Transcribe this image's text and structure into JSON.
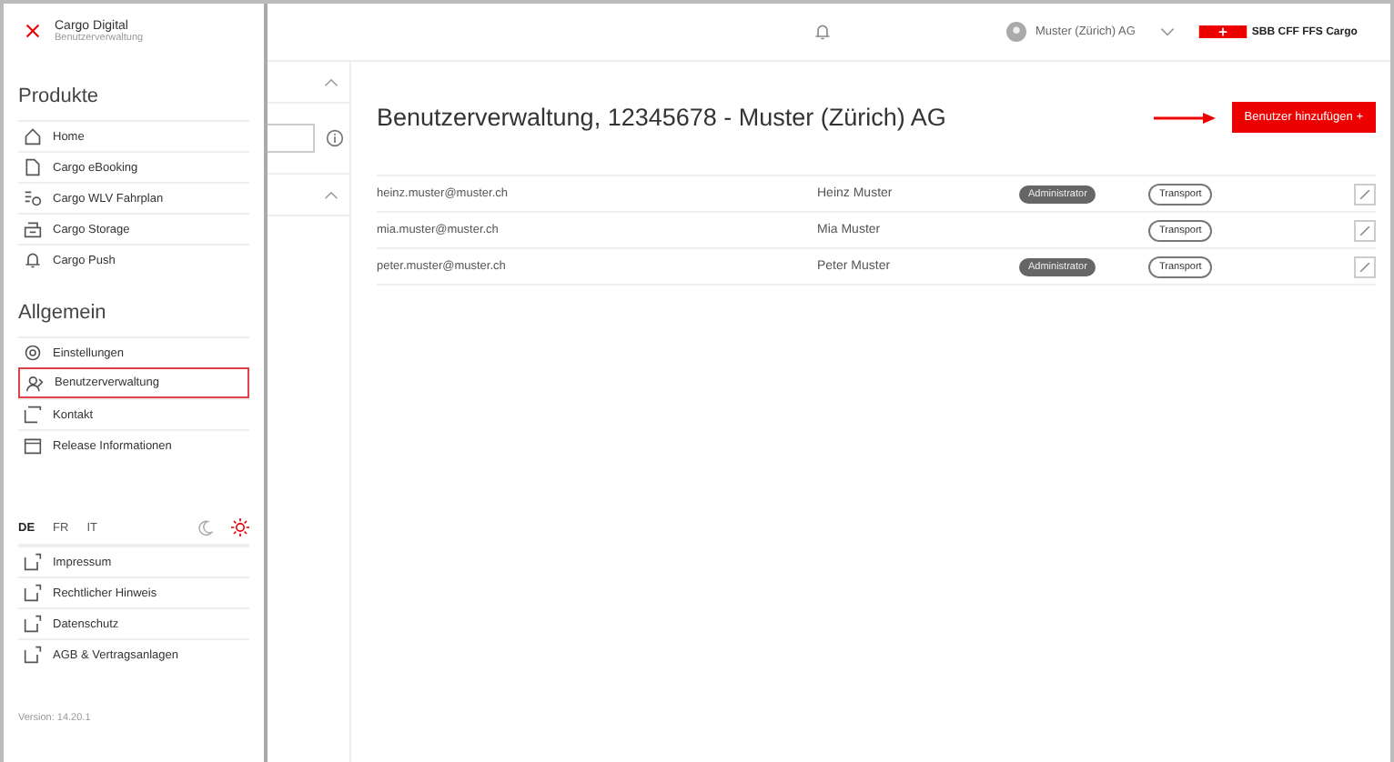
{
  "sidebar": {
    "title": "Cargo Digital",
    "subtitle": "Benutzerverwaltung",
    "sections": [
      {
        "heading": "Produkte",
        "items": [
          {
            "label": "Home",
            "kind": "home",
            "selected": false
          },
          {
            "label": "Cargo eBooking",
            "kind": "doc",
            "selected": false
          },
          {
            "label": "Cargo WLV Fahrplan",
            "kind": "schedule",
            "selected": false
          },
          {
            "label": "Cargo Storage",
            "kind": "storage",
            "selected": false
          },
          {
            "label": "Cargo Push",
            "kind": "bell",
            "selected": false
          }
        ]
      },
      {
        "heading": "Allgemein",
        "items": [
          {
            "label": "Einstellungen",
            "kind": "gear",
            "selected": false
          },
          {
            "label": "Benutzerverwaltung",
            "kind": "user",
            "selected": true
          },
          {
            "label": "Kontakt",
            "kind": "external",
            "selected": false
          },
          {
            "label": "Release Informationen",
            "kind": "window",
            "selected": false
          }
        ]
      }
    ],
    "languages": [
      {
        "label": "DE",
        "selected": true
      },
      {
        "label": "FR",
        "selected": false
      },
      {
        "label": "IT",
        "selected": false
      }
    ],
    "themes": [
      {
        "kind": "moon",
        "selected": false
      },
      {
        "kind": "sun",
        "selected": true
      }
    ],
    "links": [
      "Impressum",
      "Rechtlicher Hinweis",
      "Datenschutz",
      "AGB & Vertragsanlagen"
    ],
    "version": "Version: 14.20.1"
  },
  "header": {
    "account": "Muster (Zürich) AG",
    "logo": "SBB CFF FFS Cargo"
  },
  "main": {
    "title": "Benutzerverwaltung, 12345678 - Muster (Zürich) AG",
    "add_button": "Benutzer hinzufügen +",
    "users": [
      {
        "email": "heinz.muster@muster.ch",
        "name": "Heinz Muster",
        "roles": [
          {
            "label": "Administrator",
            "kind": "filled"
          },
          {
            "label": "Transport",
            "kind": "outline"
          }
        ]
      },
      {
        "email": "mia.muster@muster.ch",
        "name": "Mia Muster",
        "roles": [
          {
            "label": "Transport",
            "kind": "outline"
          }
        ]
      },
      {
        "email": "peter.muster@muster.ch",
        "name": "Peter Muster",
        "roles": [
          {
            "label": "Administrator",
            "kind": "filled"
          },
          {
            "label": "Transport",
            "kind": "outline"
          }
        ]
      }
    ]
  }
}
